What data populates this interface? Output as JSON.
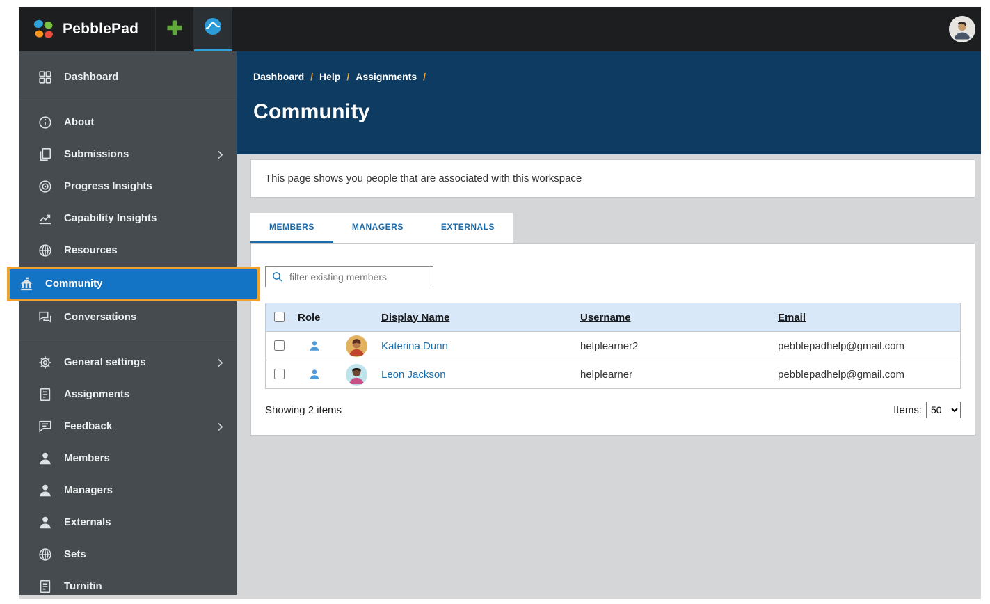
{
  "topbar": {
    "brand": "PebblePad",
    "apps": [
      {
        "name": "pebble-plus-app",
        "active": false
      },
      {
        "name": "atlas-app",
        "active": true
      }
    ]
  },
  "sidebar": {
    "items": [
      {
        "label": "Dashboard",
        "icon": "dashboard-icon",
        "active": false,
        "chevron": false,
        "divider_after": true
      },
      {
        "label": "About",
        "icon": "info-icon",
        "active": false,
        "chevron": false,
        "divider_after": false
      },
      {
        "label": "Submissions",
        "icon": "copy-icon",
        "active": false,
        "chevron": true,
        "divider_after": false
      },
      {
        "label": "Progress Insights",
        "icon": "target-icon",
        "active": false,
        "chevron": false,
        "divider_after": false
      },
      {
        "label": "Capability Insights",
        "icon": "chart-icon",
        "active": false,
        "chevron": false,
        "divider_after": false
      },
      {
        "label": "Resources",
        "icon": "sphere-icon",
        "active": false,
        "chevron": false,
        "divider_after": false
      },
      {
        "label": "Community",
        "icon": "community-icon",
        "active": true,
        "chevron": false,
        "divider_after": false
      },
      {
        "label": "Conversations",
        "icon": "chat-icon",
        "active": false,
        "chevron": false,
        "divider_after": true
      },
      {
        "label": "General settings",
        "icon": "gear-icon",
        "active": false,
        "chevron": true,
        "divider_after": false
      },
      {
        "label": "Assignments",
        "icon": "document-icon",
        "active": false,
        "chevron": false,
        "divider_after": false
      },
      {
        "label": "Feedback",
        "icon": "feedback-icon",
        "active": false,
        "chevron": true,
        "divider_after": false
      },
      {
        "label": "Members",
        "icon": "person-icon",
        "active": false,
        "chevron": false,
        "divider_after": false
      },
      {
        "label": "Managers",
        "icon": "person-icon",
        "active": false,
        "chevron": false,
        "divider_after": false
      },
      {
        "label": "Externals",
        "icon": "person-icon",
        "active": false,
        "chevron": false,
        "divider_after": false
      },
      {
        "label": "Sets",
        "icon": "sphere-icon",
        "active": false,
        "chevron": false,
        "divider_after": false
      },
      {
        "label": "Turnitin",
        "icon": "document-icon",
        "active": false,
        "chevron": false,
        "divider_after": false
      }
    ]
  },
  "breadcrumb": [
    "Dashboard",
    "Help",
    "Assignments"
  ],
  "page": {
    "title": "Community",
    "description": "This page shows you people that are associated with this workspace"
  },
  "tabs": [
    {
      "label": "MEMBERS",
      "active": true
    },
    {
      "label": "MANAGERS",
      "active": false
    },
    {
      "label": "EXTERNALS",
      "active": false
    }
  ],
  "filter": {
    "placeholder": "filter existing members"
  },
  "members_table": {
    "headers": {
      "role": "Role",
      "display_name": "Display Name",
      "username": "Username",
      "email": "Email"
    },
    "rows": [
      {
        "display_name": "Katerina Dunn",
        "username": "helplearner2",
        "email": "pebblepadhelp@gmail.com"
      },
      {
        "display_name": "Leon Jackson",
        "username": "helplearner",
        "email": "pebblepadhelp@gmail.com"
      }
    ]
  },
  "footer": {
    "showing": "Showing 2 items",
    "items_label": "Items:",
    "items_per_page": "50"
  },
  "colors": {
    "accent_blue": "#1373c5",
    "highlight_orange": "#f0a12b",
    "header_navy": "#0e3b61",
    "table_header_bg": "#d9e8f9",
    "link_blue": "#1c6fad"
  }
}
